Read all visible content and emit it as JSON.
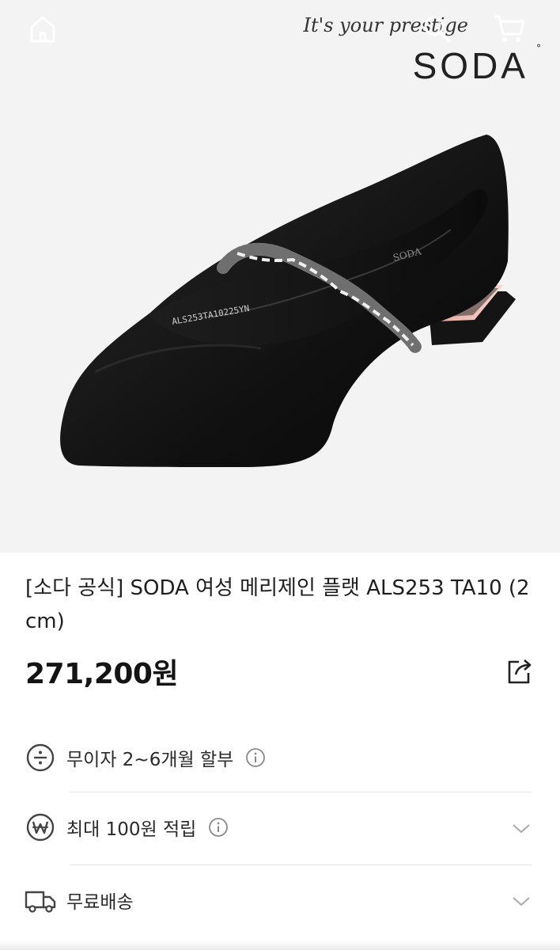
{
  "header": {
    "tagline": "It's your prestige",
    "logo": "SODA",
    "logo_mark": "°",
    "icons": [
      "home-icon",
      "search-icon",
      "cart-icon"
    ]
  },
  "product_image": {
    "insole_print": "ALS253TA10225YN",
    "insole_logo": "SODA"
  },
  "product": {
    "title": "[소다 공식] SODA 여성 메리제인 플랫 ALS253 TA10 (2cm)",
    "price": "271,200원"
  },
  "benefits": [
    {
      "icon": "installment-icon",
      "label": "무이자 2~6개월 할부",
      "has_info": true,
      "has_chevron": false
    },
    {
      "icon": "won-coin-icon",
      "label": "최대 100원 적립",
      "has_info": true,
      "has_chevron": true
    },
    {
      "icon": "delivery-truck-icon",
      "label": "무료배송",
      "has_info": false,
      "has_chevron": true
    }
  ],
  "colors": {
    "background": "#ffffff",
    "hero_background": "#f3f3f3",
    "text": "#1f1f1f",
    "divider": "#e6e6e6",
    "icon": "#444444"
  }
}
